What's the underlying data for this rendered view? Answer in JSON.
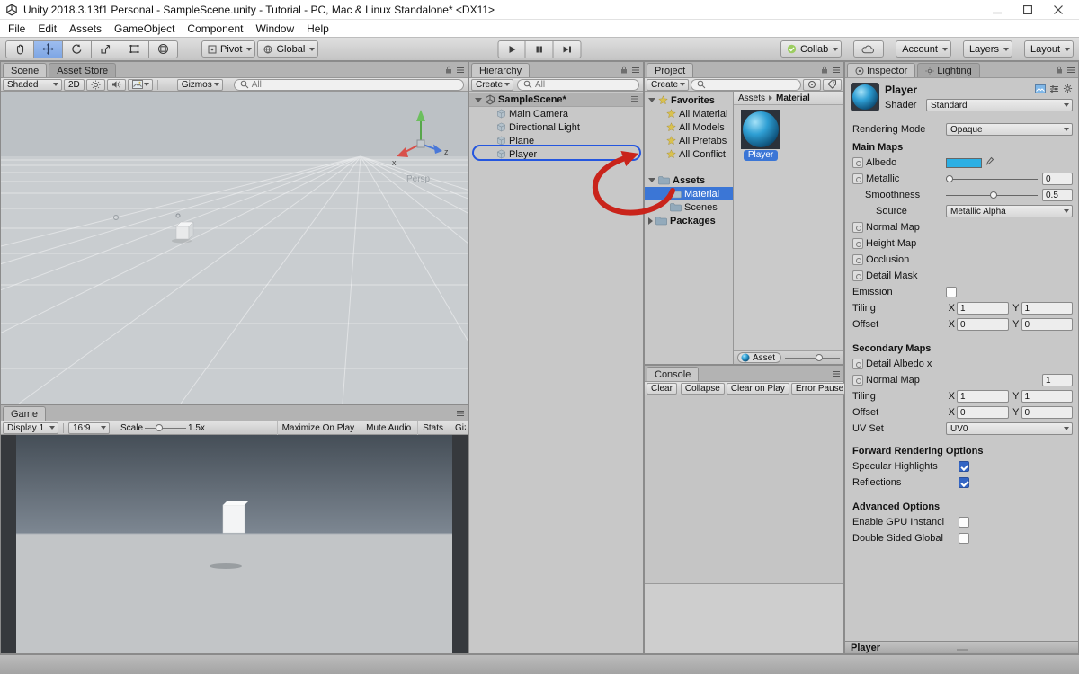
{
  "window": {
    "title": "Unity 2018.3.13f1 Personal - SampleScene.unity - Tutorial - PC, Mac & Linux Standalone* <DX11>"
  },
  "menu": {
    "items": [
      "File",
      "Edit",
      "Assets",
      "GameObject",
      "Component",
      "Window",
      "Help"
    ]
  },
  "toolbar": {
    "pivot": "Pivot",
    "global": "Global",
    "collab": "Collab",
    "account": "Account",
    "layers": "Layers",
    "layout": "Layout"
  },
  "scene": {
    "tab_scene": "Scene",
    "tab_asset_store": "Asset Store",
    "shaded": "Shaded",
    "mode_2d": "2D",
    "gizmos": "Gizmos",
    "search_value": "All",
    "persp": "Persp",
    "axis_z": "z",
    "axis_x": "x"
  },
  "game": {
    "tab": "Game",
    "display": "Display 1",
    "aspect": "16:9",
    "scale_label": "Scale",
    "scale_value": "1.5x",
    "maximize": "Maximize On Play",
    "mute": "Mute Audio",
    "stats": "Stats",
    "gizmos": "Gizmos"
  },
  "hierarchy": {
    "tab": "Hierarchy",
    "create": "Create",
    "search_value": "All",
    "scene_row": "SampleScene*",
    "items": [
      {
        "label": "Main Camera"
      },
      {
        "label": "Directional Light"
      },
      {
        "label": "Plane"
      },
      {
        "label": "Player"
      }
    ]
  },
  "project": {
    "tab": "Project",
    "create": "Create",
    "favorites_label": "Favorites",
    "favorite_items": [
      "All Material",
      "All Models",
      "All Prefabs",
      "All Conflict"
    ],
    "assets_label": "Assets",
    "asset_folders": [
      "Material",
      "Scenes"
    ],
    "packages_label": "Packages",
    "breadcrumb_root": "Assets",
    "breadcrumb_current": "Material",
    "selected_asset": "Player",
    "footer_label": "Asset"
  },
  "console": {
    "tab": "Console",
    "buttons": {
      "clear": "Clear",
      "collapse": "Collapse",
      "clear_on_play": "Clear on Play",
      "error_pause": "Error Pause"
    }
  },
  "inspector": {
    "tab_inspector": "Inspector",
    "tab_lighting": "Lighting",
    "material_name": "Player",
    "shader_label": "Shader",
    "shader_value": "Standard",
    "rendering_mode_label": "Rendering Mode",
    "rendering_mode_value": "Opaque",
    "main_maps": {
      "title": "Main Maps",
      "albedo": "Albedo",
      "metallic": "Metallic",
      "metallic_value": "0",
      "smoothness": "Smoothness",
      "smoothness_value": "0.5",
      "source": "Source",
      "source_value": "Metallic Alpha",
      "normal_map": "Normal Map",
      "height_map": "Height Map",
      "occlusion": "Occlusion",
      "detail_mask": "Detail Mask",
      "emission": "Emission",
      "tiling": "Tiling",
      "offset": "Offset",
      "x": "X",
      "y": "Y",
      "tiling_x": "1",
      "tiling_y": "1",
      "offset_x": "0",
      "offset_y": "0"
    },
    "secondary_maps": {
      "title": "Secondary Maps",
      "detail_albedo": "Detail Albedo x",
      "normal_map": "Normal Map",
      "normal_value": "1",
      "tiling": "Tiling",
      "offset": "Offset",
      "x": "X",
      "y": "Y",
      "tiling_x": "1",
      "tiling_y": "1",
      "offset_x": "0",
      "offset_y": "0",
      "uv_set": "UV Set",
      "uv_value": "UV0"
    },
    "forward": {
      "title": "Forward Rendering Options",
      "specular": "Specular Highlights",
      "reflections": "Reflections"
    },
    "advanced": {
      "title": "Advanced Options",
      "gpu": "Enable GPU Instanci",
      "double_sided": "Double Sided Global"
    },
    "preview_name": "Player"
  },
  "colors": {
    "albedo_swatch": "#2bafe4",
    "selection_blue": "#3b76d6",
    "annotation_red": "#c9241b",
    "annotation_blue": "#2456df"
  }
}
